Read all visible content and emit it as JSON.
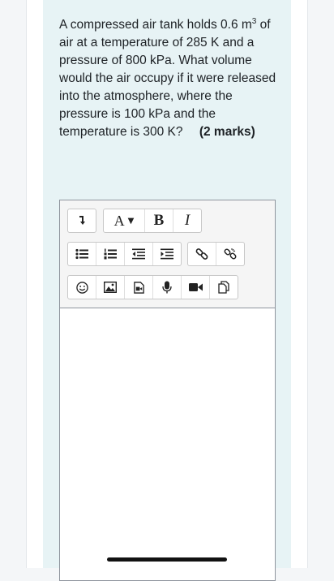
{
  "question": {
    "line1_pre": "A compressed air tank holds 0.6 m",
    "line1_sup": "3",
    "body": "of air at a temperature of 285 K and a pressure of 800 kPa. What volume would the air occupy if it were released into the atmosphere, where the pressure is 100 kPa and the temperature is 300 K?",
    "marks": "(2 marks)"
  },
  "toolbar": {
    "font_label": "A",
    "bold_label": "B",
    "italic_label": "I"
  },
  "icons": {
    "toggle": "arrow-down-to-bar-icon",
    "font_color": "font-color-icon",
    "bold": "bold-icon",
    "italic": "italic-icon",
    "unordered_list": "unordered-list-icon",
    "ordered_list": "ordered-list-icon",
    "outdent": "outdent-icon",
    "indent": "indent-icon",
    "link": "link-icon",
    "unlink": "unlink-icon",
    "emoji": "emoji-icon",
    "image": "image-icon",
    "media": "media-icon",
    "record_audio": "microphone-icon",
    "record_video": "video-camera-icon",
    "manage_files": "manage-files-icon"
  },
  "colors": {
    "panel_bg": "#e7f3f5",
    "toolbar_bg": "#f5f5f5",
    "text": "#1d2125"
  }
}
